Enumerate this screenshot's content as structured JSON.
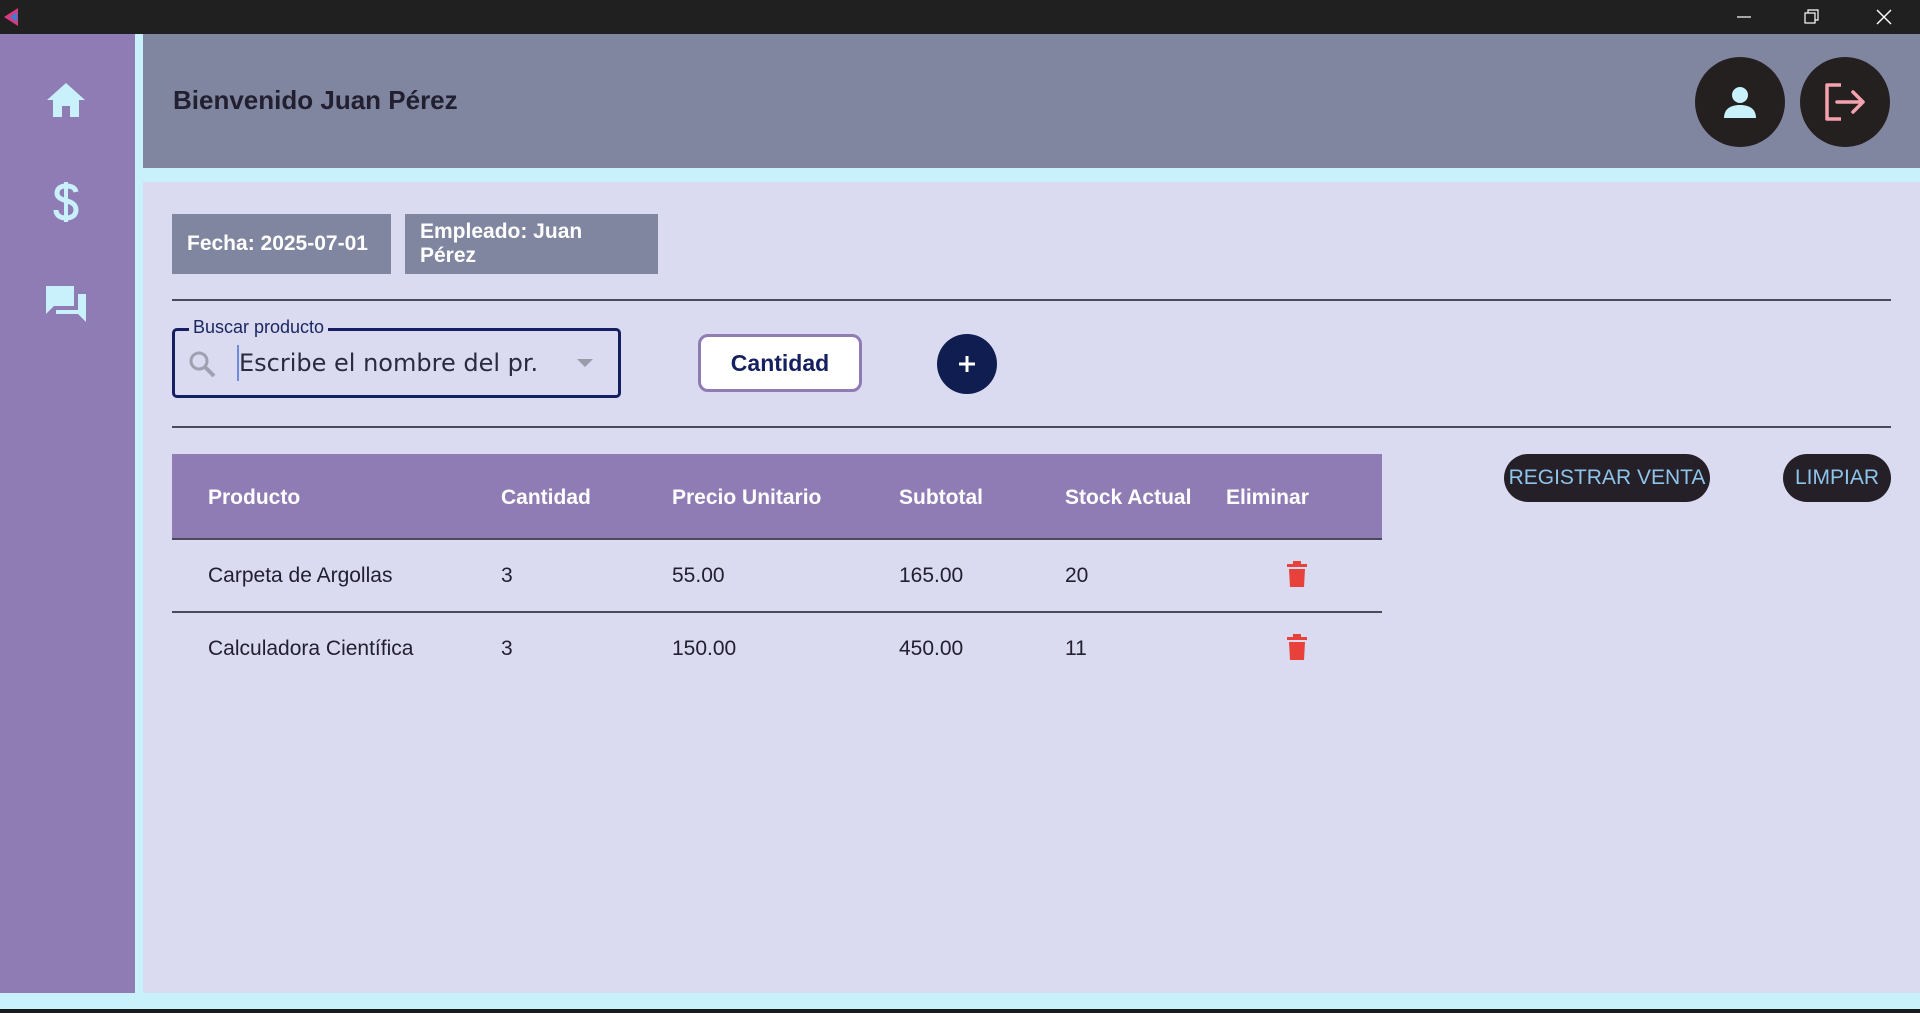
{
  "header": {
    "welcome": "Bienvenido Juan Pérez"
  },
  "sidebar": {
    "items": [
      {
        "icon": "home-icon"
      },
      {
        "icon": "dollar-icon"
      },
      {
        "icon": "chat-icon"
      }
    ]
  },
  "info": {
    "date": "Fecha: 2025-07-01",
    "employee": "Empleado: Juan Pérez"
  },
  "search": {
    "legend": "Buscar producto",
    "placeholder": "Escribe el nombre del pr..."
  },
  "quantity_label": "Cantidad",
  "table": {
    "columns": [
      "Producto",
      "Cantidad",
      "Precio Unitario",
      "Subtotal",
      "Stock Actual",
      "Eliminar"
    ],
    "rows": [
      {
        "producto": "Carpeta de Argollas",
        "cantidad": "3",
        "precio": "55.00",
        "subtotal": "165.00",
        "stock": "20"
      },
      {
        "producto": "Calculadora Científica",
        "cantidad": "3",
        "precio": "150.00",
        "subtotal": "450.00",
        "stock": "11"
      }
    ]
  },
  "actions": {
    "register": "REGISTRAR VENTA",
    "clear": "LIMPIAR"
  },
  "colors": {
    "sidebar": "#8f7cb4",
    "header": "#8186a0",
    "accent_stripe": "#c8f1fb",
    "delete": "#e8403a",
    "dark_button": "#252028"
  }
}
